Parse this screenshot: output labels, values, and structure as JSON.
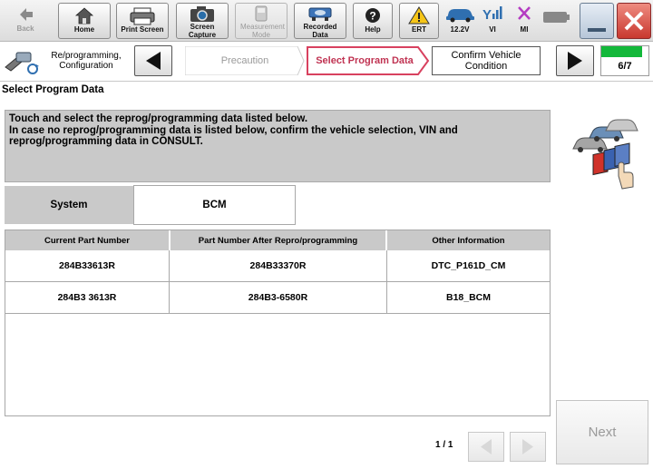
{
  "toolbar": {
    "back": "Back",
    "home": "Home",
    "print_screen": "Print Screen",
    "screen_capture": "Screen Capture",
    "measurement_mode": "Measurement Mode",
    "recorded_data": "Recorded Data",
    "help": "Help",
    "ert": "ERT",
    "voltage": "12.2V",
    "vi": "VI",
    "mi": "MI"
  },
  "nav": {
    "section_label": "Re/programming, Configuration",
    "steps": [
      "Precaution",
      "Select Program Data",
      "Confirm Vehicle Condition"
    ],
    "progress": "6/7",
    "progress_value": 0.857
  },
  "page": {
    "title": "Select Program Data",
    "instructions": [
      "Touch and select the reprog/programming data listed below.",
      "In case no reprog/programming data is listed below, confirm the vehicle selection, VIN and",
      "reprog/programming data in CONSULT."
    ]
  },
  "system": {
    "label": "System",
    "value": "BCM"
  },
  "table": {
    "columns": [
      "Current Part Number",
      "Part Number After Repro/programming",
      "Other Information"
    ],
    "rows": [
      [
        "284B33613R",
        "284B33370R",
        "DTC_P161D_CM"
      ],
      [
        "284B3 3613R",
        "284B3-6580R",
        "B18_BCM"
      ]
    ]
  },
  "pagination": {
    "label": "1 / 1"
  },
  "actions": {
    "next": "Next"
  },
  "colors": {
    "accent": "#d8415f",
    "progress_green": "#13b83a",
    "close_red": "#d63b3b"
  }
}
